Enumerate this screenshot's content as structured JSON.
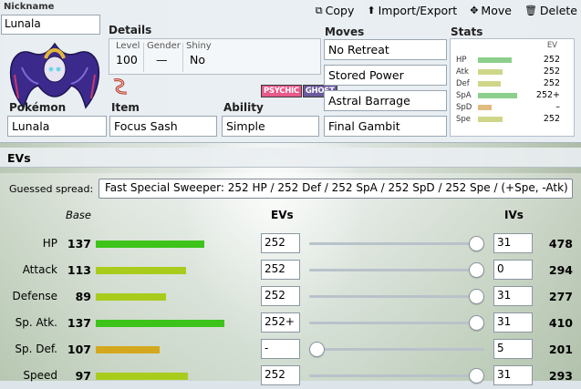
{
  "actions": {
    "copy": "Copy",
    "import_export": "Import/Export",
    "move": "Move",
    "delete": "Delete"
  },
  "nickname": {
    "label": "Nickname",
    "value": "Lunala"
  },
  "details": {
    "title": "Details",
    "level_label": "Level",
    "level": "100",
    "gender_label": "Gender",
    "gender": "—",
    "shiny_label": "Shiny",
    "shiny": "No"
  },
  "types": [
    "PSYCHIC",
    "GHOST"
  ],
  "pokemon": {
    "label": "Pokémon",
    "value": "Lunala"
  },
  "item": {
    "label": "Item",
    "value": "Focus Sash"
  },
  "ability": {
    "label": "Ability",
    "value": "Simple"
  },
  "moves": {
    "title": "Moves",
    "list": [
      "No Retreat",
      "Stored Power",
      "Astral Barrage",
      "Final Gambit"
    ]
  },
  "stats": {
    "title": "Stats",
    "ev_header": "EV",
    "rows": [
      {
        "label": "HP",
        "ev": "252",
        "fill": 0.53,
        "color": "#8ccf8c"
      },
      {
        "label": "Atk",
        "ev": "252",
        "fill": 0.38,
        "color": "#cfd68a"
      },
      {
        "label": "Def",
        "ev": "252",
        "fill": 0.36,
        "color": "#cfd68a"
      },
      {
        "label": "SpA",
        "ev": "252+",
        "fill": 0.62,
        "color": "#8ccf8c"
      },
      {
        "label": "SpD",
        "ev": "–",
        "fill": 0.21,
        "color": "#e0bc7f"
      },
      {
        "label": "Spe",
        "ev": "252",
        "fill": 0.38,
        "color": "#cfd68a"
      }
    ]
  },
  "evs": {
    "header": "EVs",
    "guess_label": "Guessed spread:",
    "guess_value": "Fast Special Sweeper: 252 HP / 252 Def / 252 SpA / 252 SpD / 252 Spe / (+Spe, -Atk)",
    "col_base": "Base",
    "col_evs": "EVs",
    "col_ivs": "IVs",
    "rows": [
      {
        "name": "HP",
        "base": "137",
        "base_fill": 0.54,
        "color": "#3ec31b",
        "ev": "252",
        "slider": 1.0,
        "iv": "31",
        "total": "478"
      },
      {
        "name": "Attack",
        "base": "113",
        "base_fill": 0.45,
        "color": "#a9cc1c",
        "ev": "252",
        "slider": 1.0,
        "iv": "0",
        "total": "294"
      },
      {
        "name": "Defense",
        "base": "89",
        "base_fill": 0.35,
        "color": "#a9cc1c",
        "ev": "252",
        "slider": 1.0,
        "iv": "31",
        "total": "277"
      },
      {
        "name": "Sp. Atk.",
        "base": "137",
        "base_fill": 0.64,
        "color": "#3ec31b",
        "ev": "252+",
        "slider": 1.0,
        "iv": "31",
        "total": "410"
      },
      {
        "name": "Sp. Def.",
        "base": "107",
        "base_fill": 0.32,
        "color": "#d4a81e",
        "ev": "-",
        "slider": 0.0,
        "iv": "5",
        "total": "201"
      },
      {
        "name": "Speed",
        "base": "97",
        "base_fill": 0.46,
        "color": "#a9cc1c",
        "ev": "252",
        "slider": 1.0,
        "iv": "31",
        "total": "293"
      }
    ]
  }
}
